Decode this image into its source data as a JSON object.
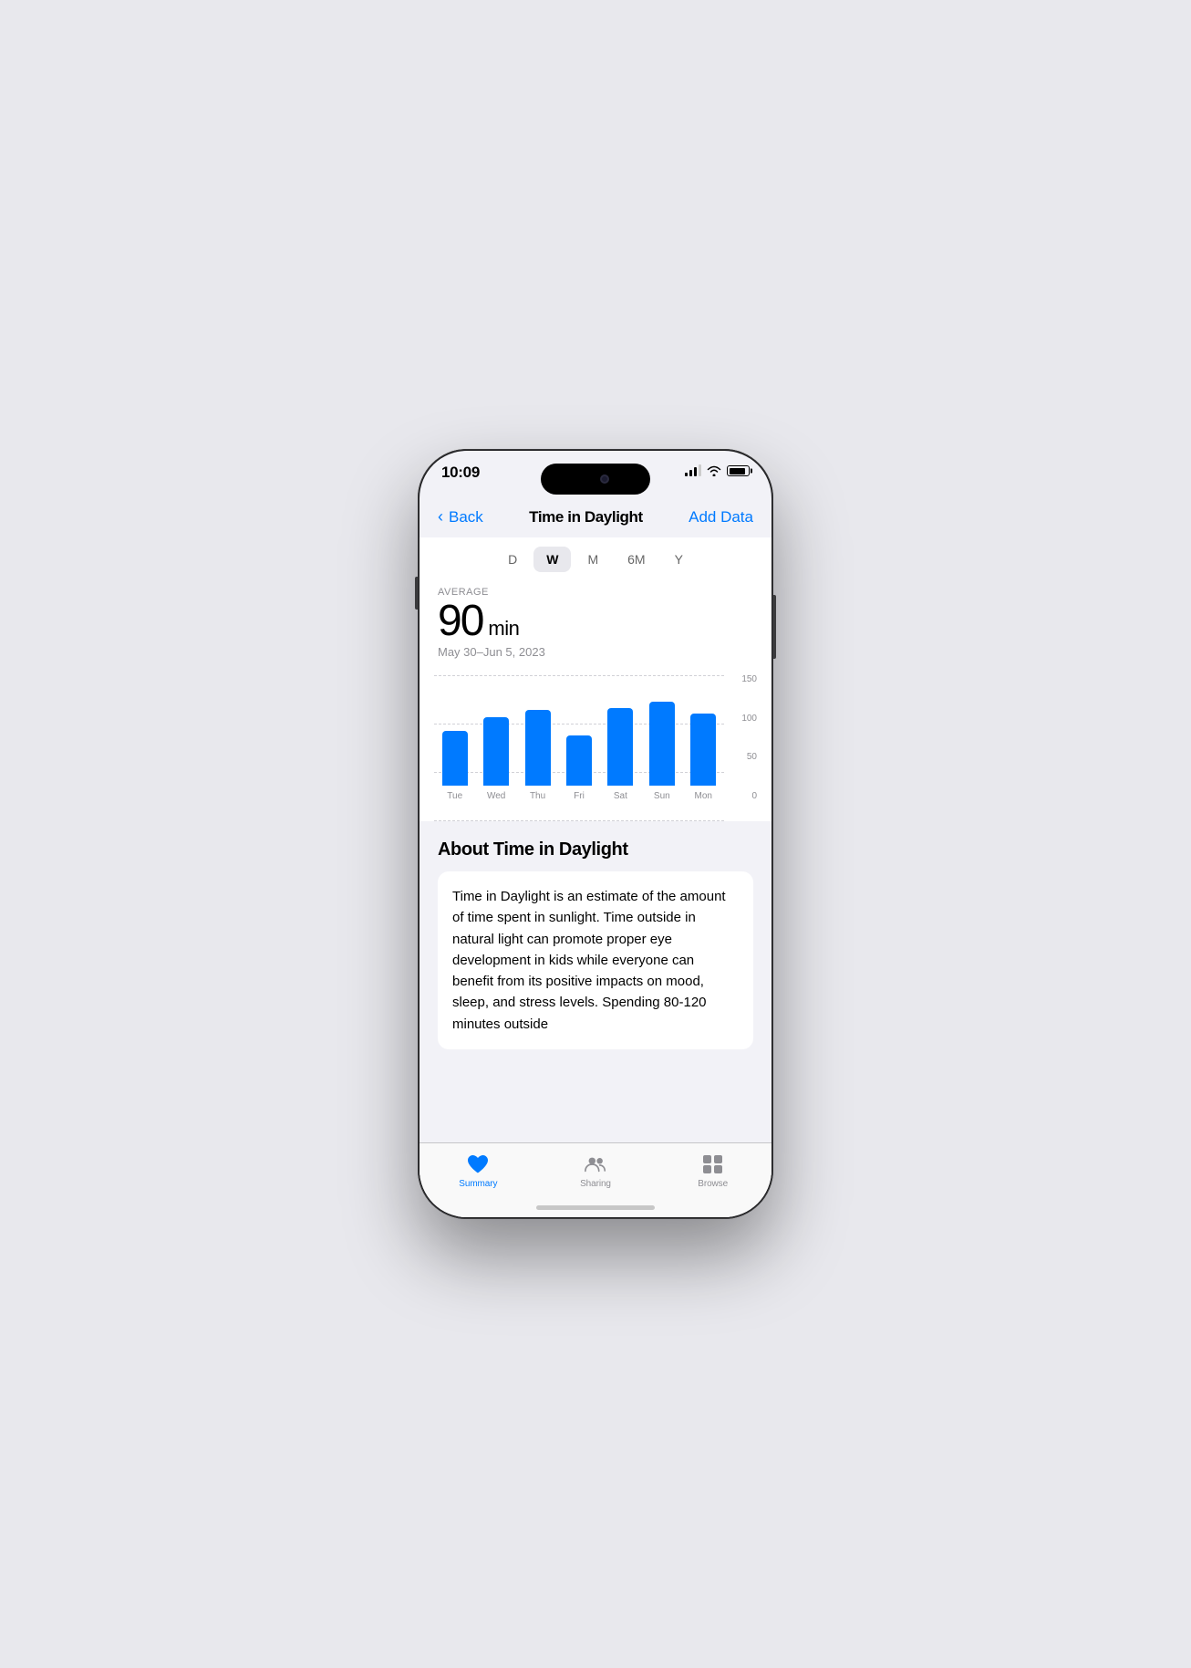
{
  "status": {
    "time": "10:09"
  },
  "nav": {
    "back_label": "Back",
    "title": "Time in Daylight",
    "action_label": "Add Data"
  },
  "time_tabs": [
    {
      "id": "D",
      "label": "D",
      "active": false
    },
    {
      "id": "W",
      "label": "W",
      "active": true
    },
    {
      "id": "M",
      "label": "M",
      "active": false
    },
    {
      "id": "6M",
      "label": "6M",
      "active": false
    },
    {
      "id": "Y",
      "label": "Y",
      "active": false
    }
  ],
  "stats": {
    "label": "AVERAGE",
    "value": "90",
    "unit": "min",
    "date_range": "May 30–Jun 5, 2023"
  },
  "chart": {
    "y_axis": [
      "150",
      "100",
      "50",
      "0"
    ],
    "bars": [
      {
        "day": "Tue",
        "value": 65,
        "max": 150
      },
      {
        "day": "Wed",
        "value": 82,
        "max": 150
      },
      {
        "day": "Thu",
        "value": 90,
        "max": 150
      },
      {
        "day": "Fri",
        "value": 60,
        "max": 150
      },
      {
        "day": "Sat",
        "value": 92,
        "max": 150
      },
      {
        "day": "Sun",
        "value": 100,
        "max": 150
      },
      {
        "day": "Mon",
        "value": 86,
        "max": 150
      }
    ]
  },
  "about": {
    "title": "About Time in Daylight",
    "text": "Time in Daylight is an estimate of the amount of time spent in sunlight. Time outside in natural light can promote proper eye development in kids while everyone can benefit from its positive impacts on mood, sleep, and stress levels. Spending 80-120 minutes outside"
  },
  "tabs": [
    {
      "id": "summary",
      "label": "Summary",
      "active": true,
      "icon": "heart"
    },
    {
      "id": "sharing",
      "label": "Sharing",
      "active": false,
      "icon": "people"
    },
    {
      "id": "browse",
      "label": "Browse",
      "active": false,
      "icon": "grid"
    }
  ]
}
